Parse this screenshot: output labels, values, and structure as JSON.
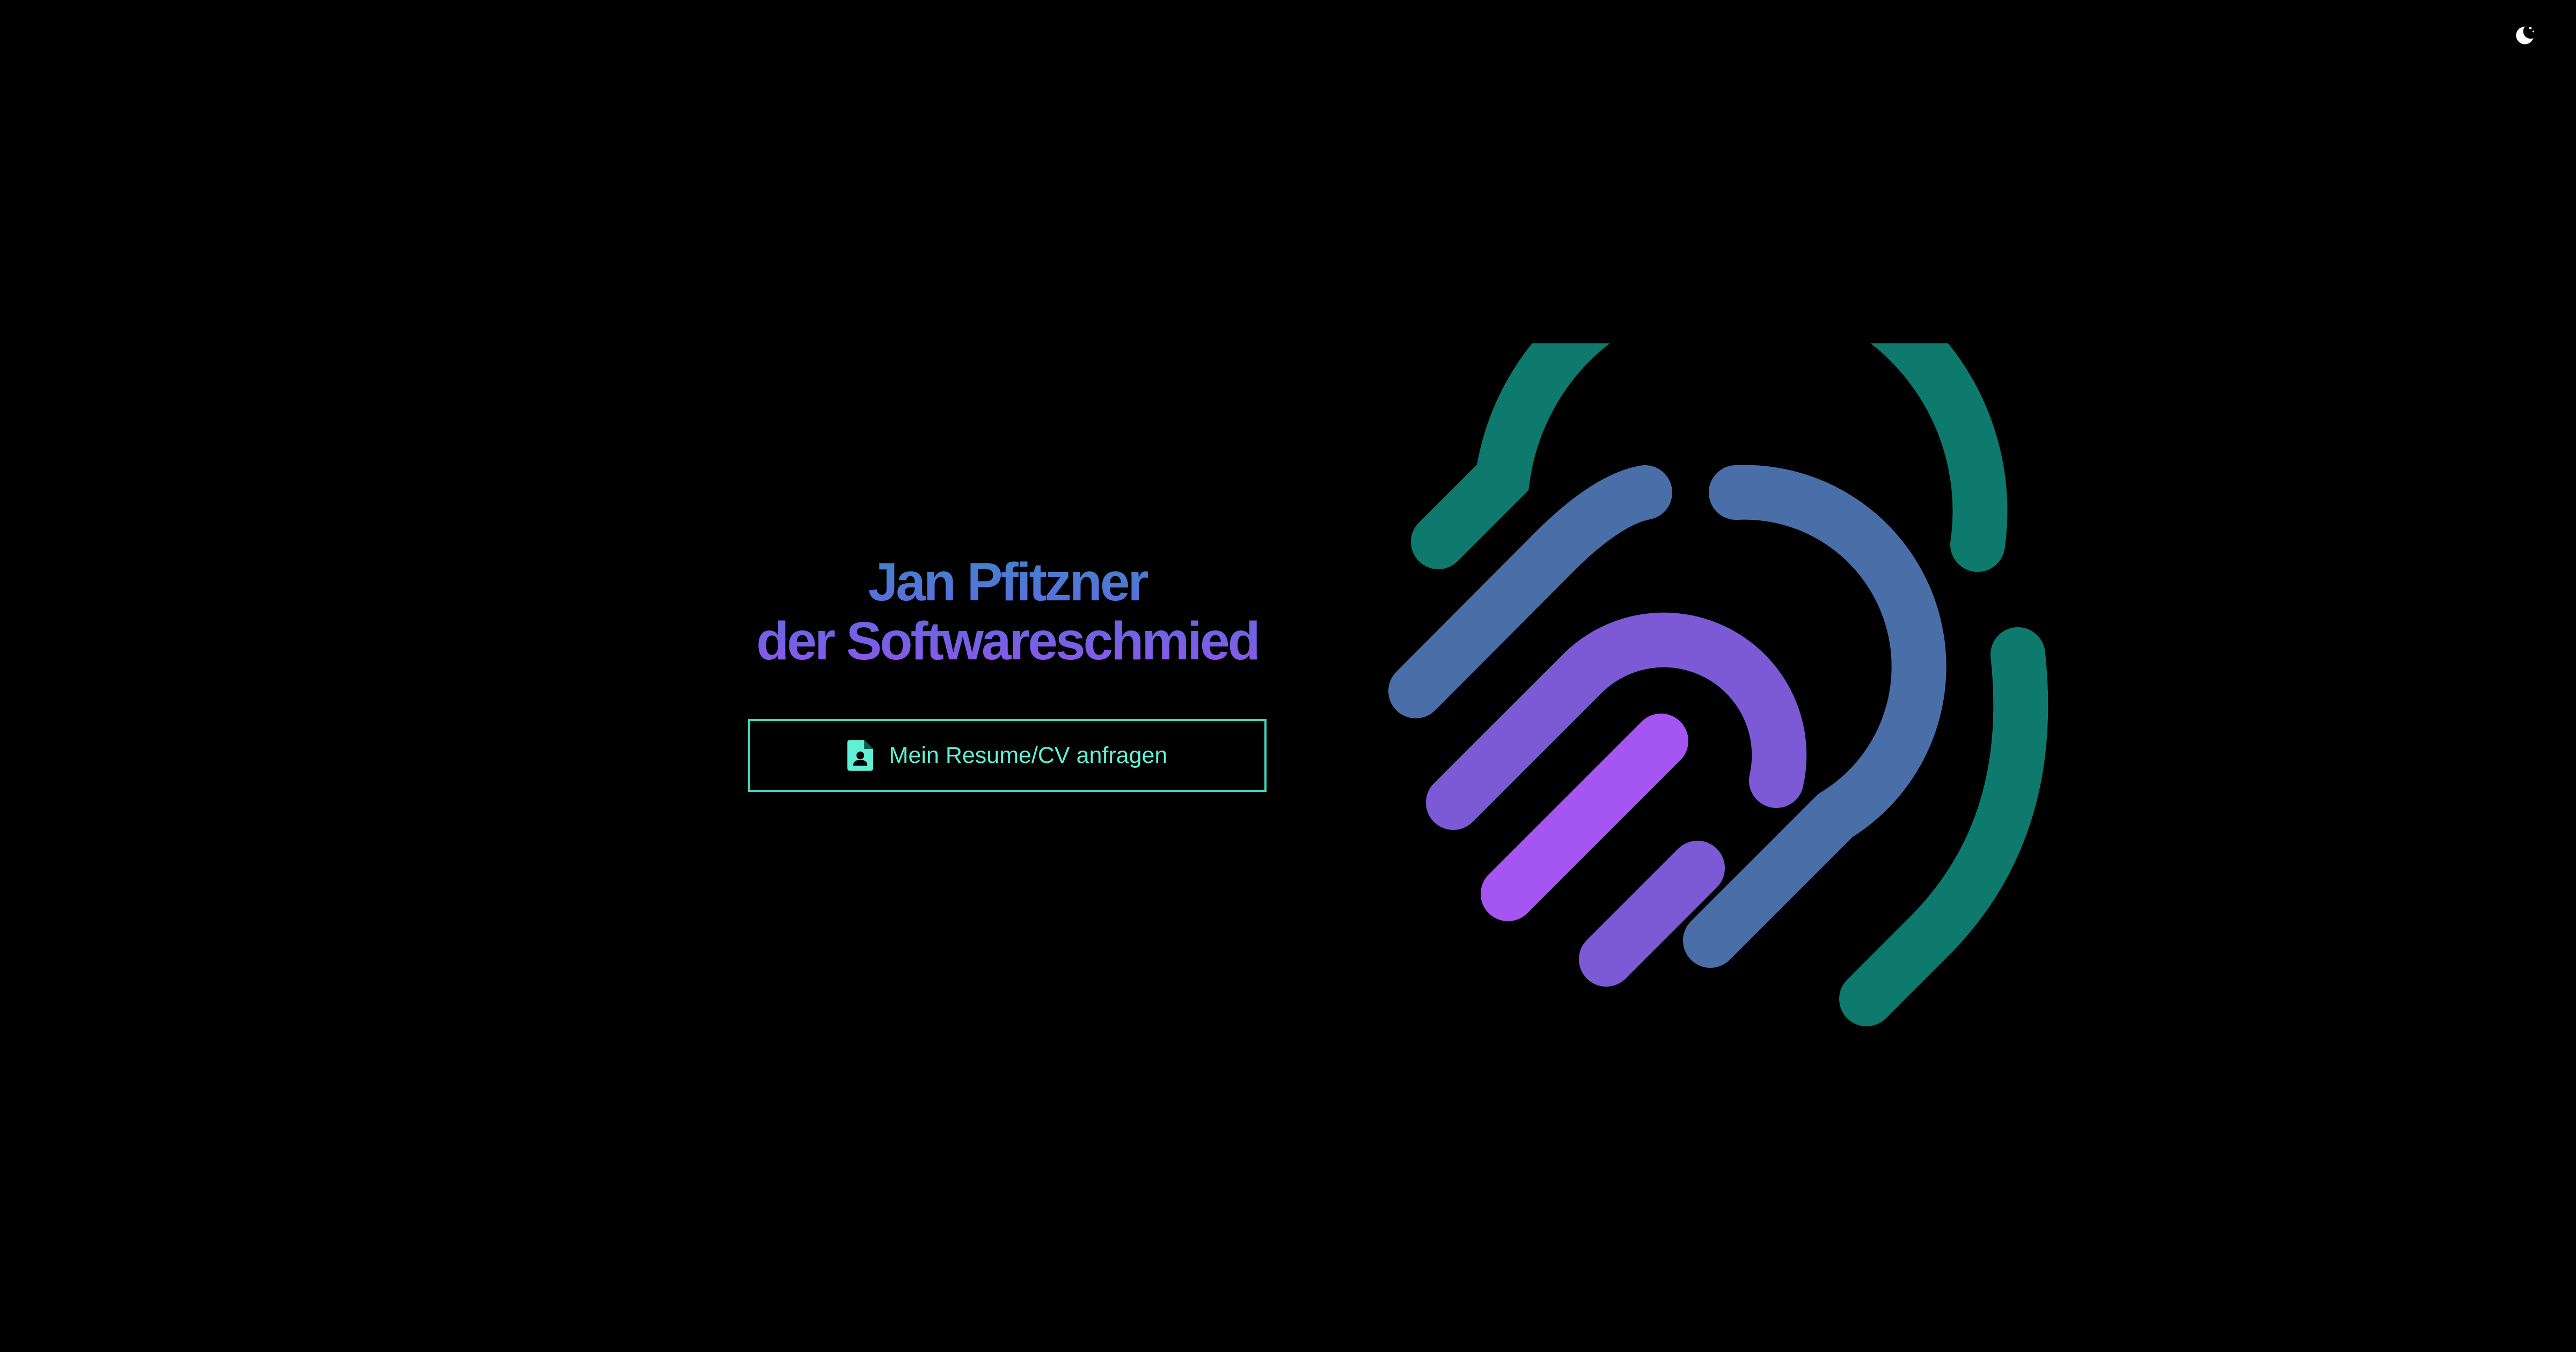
{
  "header": {
    "theme_toggle_icon": "moon-icon"
  },
  "hero": {
    "title_line1": "Jan Pfitzner",
    "title_line2": "der Softwareschmied",
    "cv_button": {
      "icon": "document-user-icon",
      "label": "Mein Resume/CV anfragen"
    }
  },
  "logo": {
    "icon": "fingerprint-logo",
    "colors": {
      "outer": "#0e7a6e",
      "middle": "#4a6ea8",
      "inner": "#7c5ad6",
      "core": "#a555f2"
    }
  },
  "colors": {
    "background": "#000000",
    "accent": "#3fd6bd",
    "title_gradient_start": "#3f86c8",
    "title_gradient_end": "#8f56ea"
  }
}
